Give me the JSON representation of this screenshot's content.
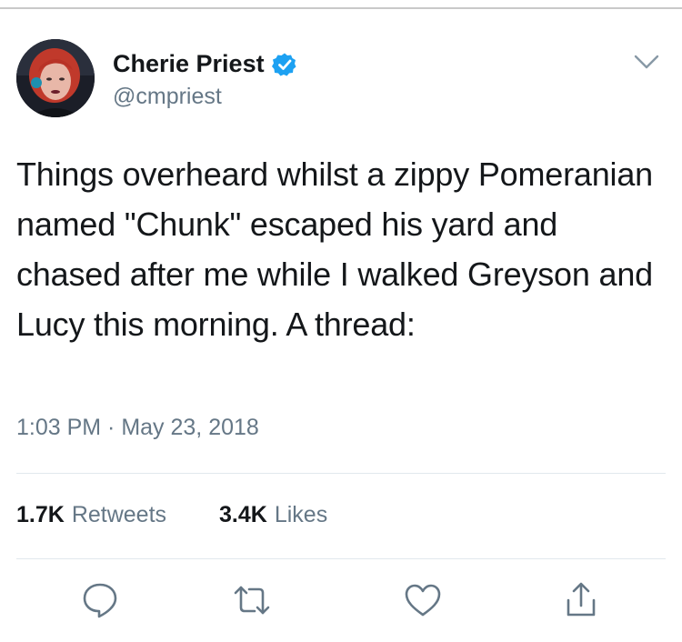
{
  "author": {
    "display_name": "Cherie Priest",
    "handle": "@cmpriest",
    "verified_icon": "verified-badge-icon",
    "avatar_icon": "avatar-photo"
  },
  "tweet": {
    "text": "Things overheard whilst a zippy Pomeranian named \"Chunk\" escaped his yard and chased after me while I walked Greyson and Lucy this morning. A thread:",
    "timestamp": "1:03 PM · May 23, 2018"
  },
  "stats": {
    "retweets_count": "1.7K",
    "retweets_label": "Retweets",
    "likes_count": "3.4K",
    "likes_label": "Likes"
  },
  "actions": [
    "reply-icon",
    "retweet-icon",
    "like-icon",
    "share-icon"
  ],
  "colors": {
    "text": "#14171a",
    "secondary": "#657786",
    "accent": "#1da1f2",
    "divider": "#e1e8ed"
  }
}
